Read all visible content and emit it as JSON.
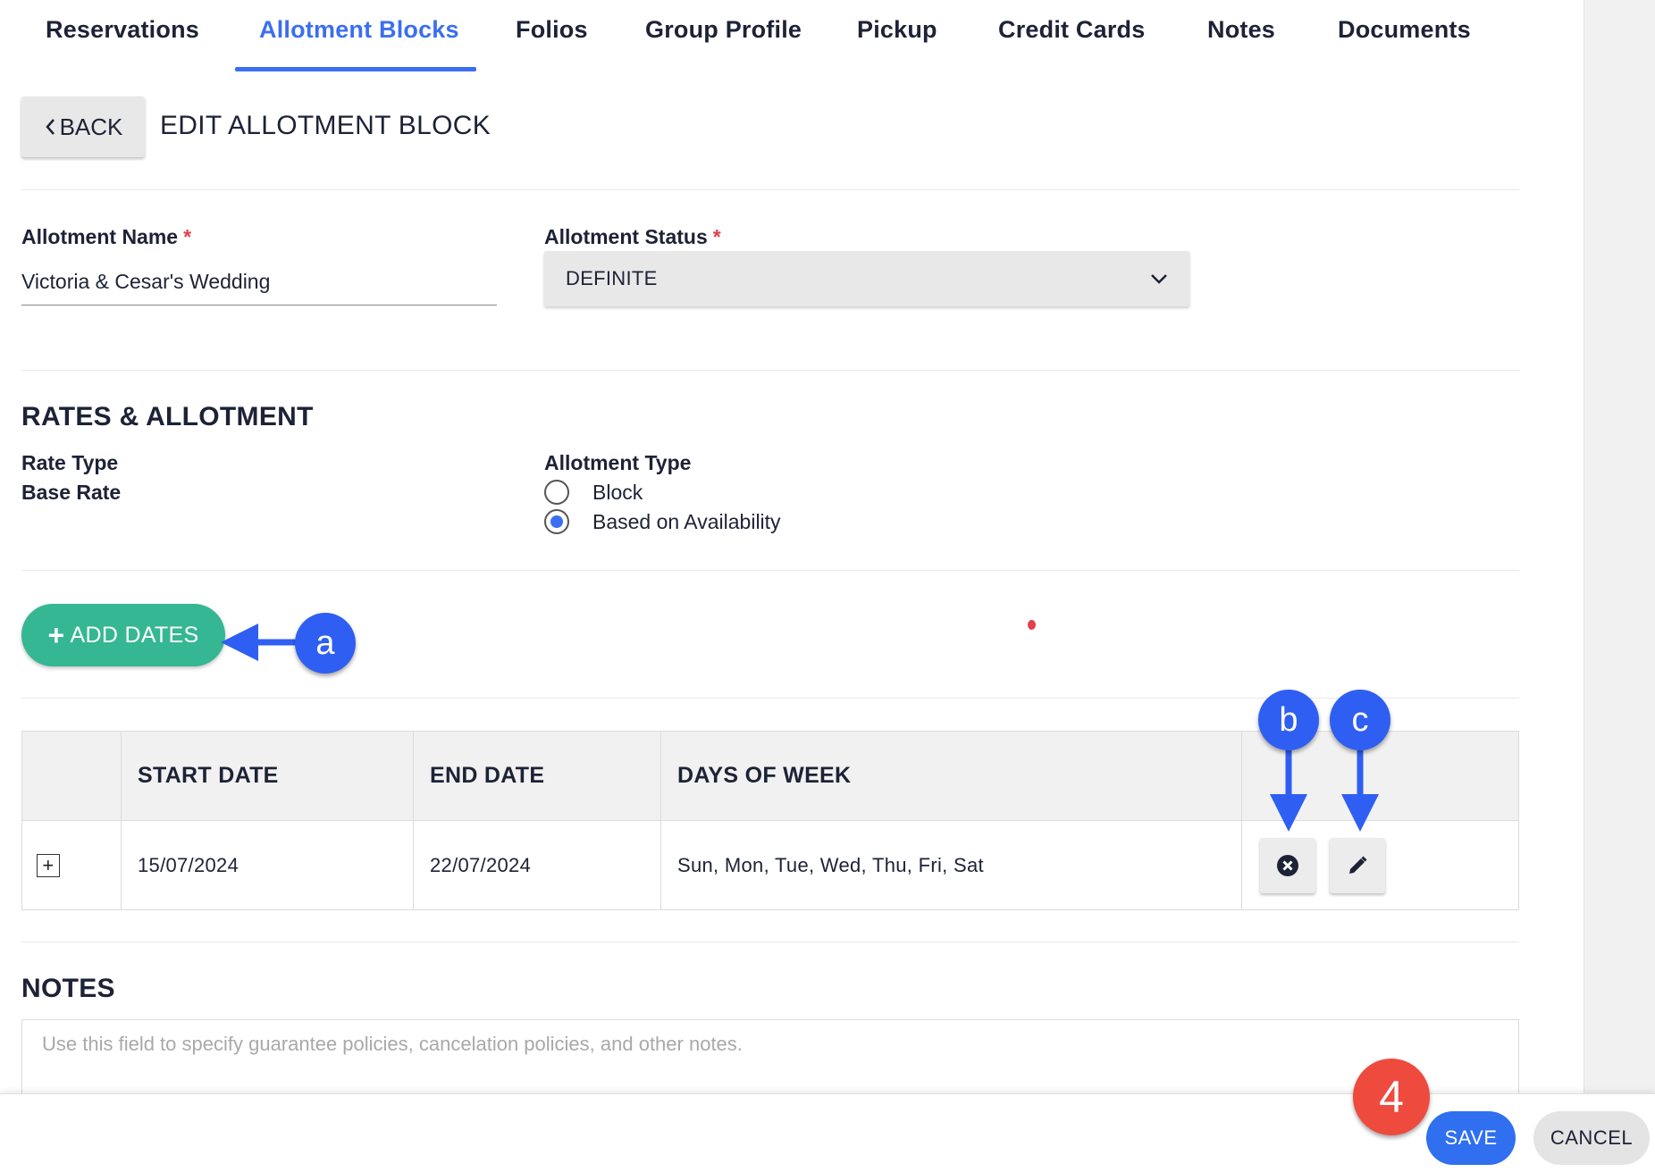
{
  "tabs": [
    {
      "label": "Reservations"
    },
    {
      "label": "Allotment Blocks"
    },
    {
      "label": "Folios"
    },
    {
      "label": "Group Profile"
    },
    {
      "label": "Pickup"
    },
    {
      "label": "Credit Cards"
    },
    {
      "label": "Notes"
    },
    {
      "label": "Documents"
    }
  ],
  "active_tab": "Allotment Blocks",
  "header": {
    "back_label": "BACK",
    "title": "EDIT ALLOTMENT BLOCK"
  },
  "form": {
    "name_label": "Allotment Name",
    "name_value": "Victoria & Cesar's Wedding",
    "status_label": "Allotment Status",
    "status_value": "DEFINITE",
    "required_mark": "*"
  },
  "rates": {
    "section_title": "RATES & ALLOTMENT",
    "rate_type_label": "Rate Type",
    "base_rate_label": "Base Rate",
    "allotment_type_label": "Allotment Type",
    "options": [
      {
        "label": "Block",
        "selected": false
      },
      {
        "label": "Based on Availability",
        "selected": true
      }
    ]
  },
  "add_dates_label": "ADD DATES",
  "table": {
    "headers": [
      "START DATE",
      "END DATE",
      "DAYS OF WEEK"
    ],
    "rows": [
      {
        "start": "15/07/2024",
        "end": "22/07/2024",
        "days": "Sun, Mon, Tue, Wed, Thu, Fri, Sat"
      }
    ]
  },
  "notes": {
    "title": "NOTES",
    "placeholder": "Use this field to specify guarantee policies, cancelation policies, and other notes."
  },
  "footer": {
    "save_label": "SAVE",
    "cancel_label": "CANCEL"
  },
  "callouts": {
    "a": "a",
    "b": "b",
    "c": "c",
    "step": "4"
  },
  "colors": {
    "accent": "#3b6ef0",
    "add_dates": "#35b793",
    "callout_blue": "#2f5ef2",
    "callout_red": "#ee4a3e",
    "required": "#e2404a"
  }
}
